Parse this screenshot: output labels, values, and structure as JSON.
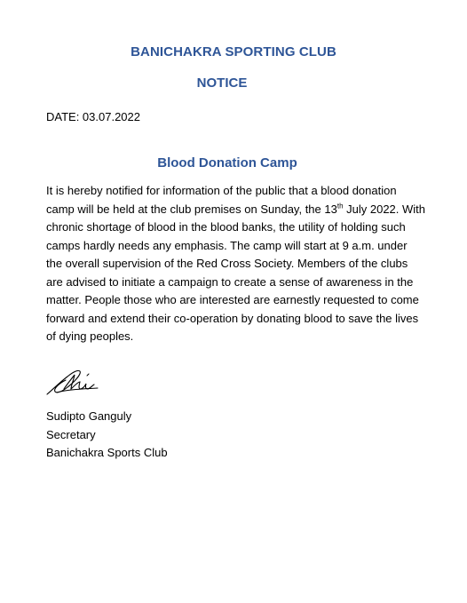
{
  "header": {
    "organization": "BANICHAKRA SPORTING CLUB",
    "notice_label": "NOTICE",
    "colors": {
      "heading": "#2E5597",
      "text": "#000000"
    }
  },
  "date": "DATE: 03.07.2022",
  "subject": "Blood Donation Camp",
  "body": {
    "part1": "It is hereby notified for information of the public that a blood donation camp will be held at the club premises on Sunday, the 13",
    "ordinal_suffix": "th",
    "part2": " July 2022. With chronic shortage of blood in the blood banks, the utility of holding such camps hardly needs any emphasis. The camp will start at 9 a.m. under the overall supervision of the Red Cross Society. Members of the clubs are advised to initiate a campaign to create a sense of awareness in the matter. People those who are interested are earnestly requested to come forward and extend their co-operation by donating blood to save the lives of dying peoples."
  },
  "signatory": {
    "name": "Sudipto Ganguly",
    "designation": "Secretary",
    "organization": "Banichakra Sports Club"
  }
}
